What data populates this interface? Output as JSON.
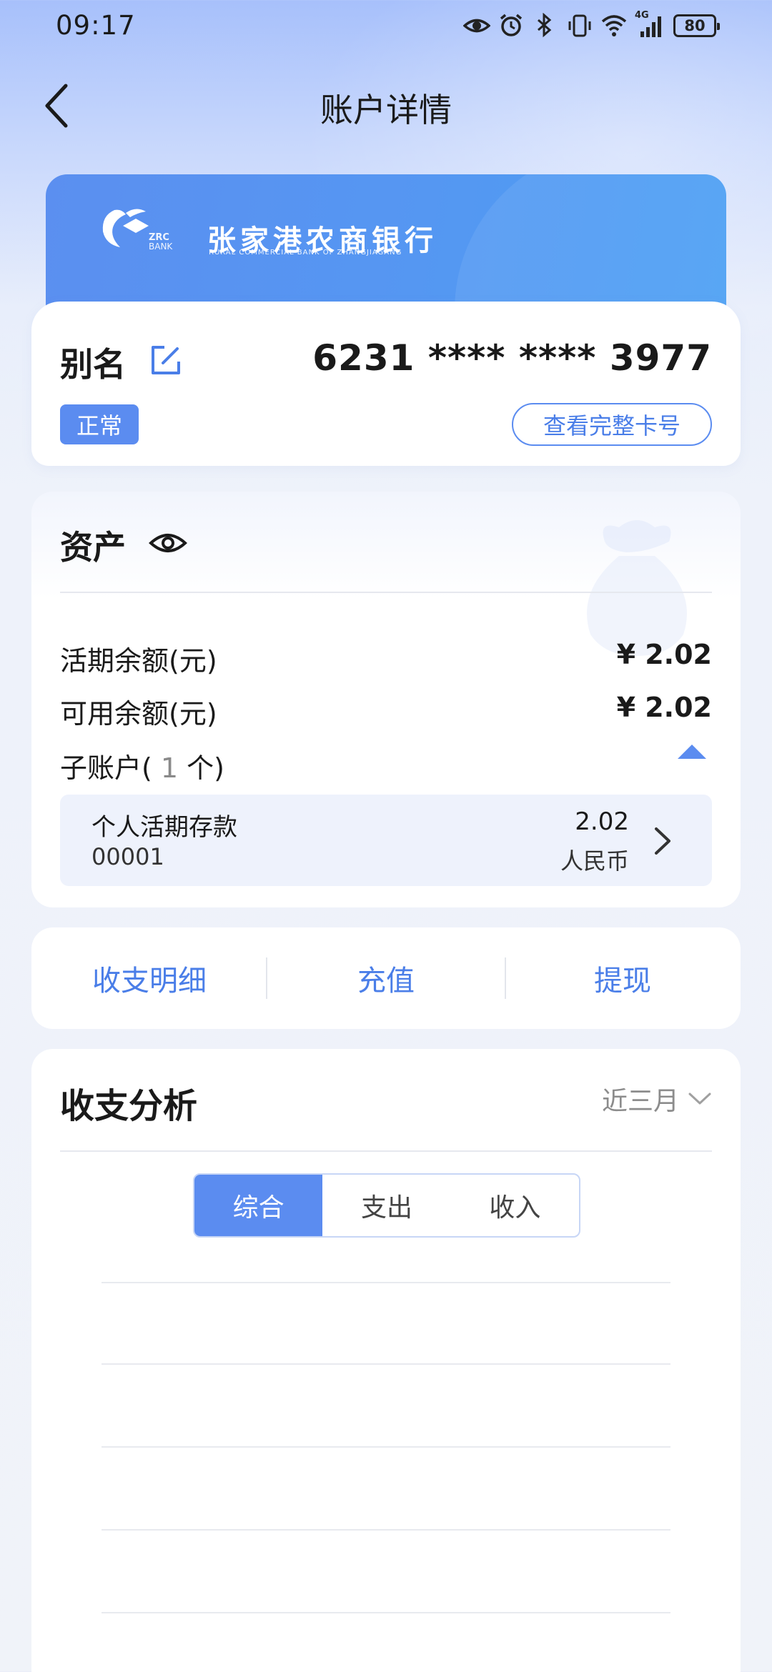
{
  "status_bar": {
    "time": "09:17",
    "network_label": "4G",
    "battery": "80",
    "icons": [
      "eye-icon",
      "alarm-icon",
      "bluetooth-icon",
      "vibrate-icon",
      "wifi-icon",
      "signal-icon",
      "battery-icon"
    ]
  },
  "nav": {
    "title": "账户详情",
    "back_icon": "chevron-left-icon"
  },
  "bank": {
    "name_cn": "张家港农商银行",
    "name_en": "RURAL COMMERCIAL BANK OF ZHANGJIAGANG",
    "logo_text_1": "ZRC",
    "logo_text_2": "BANK",
    "card_color": "#5b8ff0"
  },
  "account": {
    "alias_label": "别名",
    "card_number": "6231 **** **** 3977",
    "status": "正常",
    "view_full_label": "查看完整卡号"
  },
  "assets": {
    "title": "资产",
    "rows": [
      {
        "label": "活期余额(元)",
        "value": "¥ 2.02"
      },
      {
        "label": "可用余额(元)",
        "value": "¥ 2.02"
      }
    ],
    "sub_account_prefix": "子账户(",
    "sub_account_count": " 1 ",
    "sub_account_suffix": "个)",
    "sub_accounts": [
      {
        "name": "个人活期存款",
        "number": "00001",
        "amount": "2.02",
        "currency": "人民币"
      }
    ]
  },
  "actions": {
    "items": [
      "收支明细",
      "充值",
      "提现"
    ]
  },
  "analysis": {
    "title": "收支分析",
    "period": "近三月",
    "tabs": [
      "综合",
      "支出",
      "收入"
    ],
    "active_tab": "综合"
  },
  "colors": {
    "accent": "#5b8cf0",
    "accent_text": "#4a7ee8",
    "badge": "#5b8cf0"
  }
}
